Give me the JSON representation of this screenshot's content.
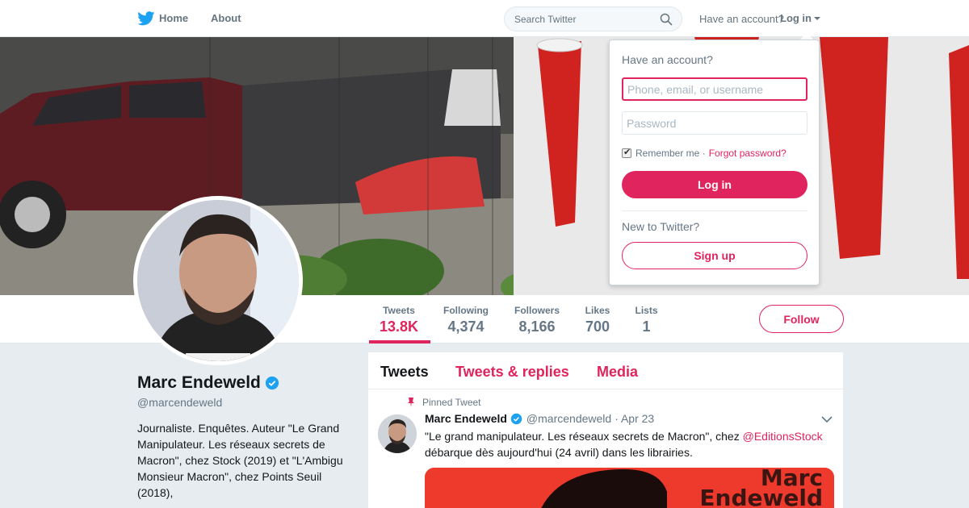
{
  "topnav": {
    "home_label": "Home",
    "about_label": "About",
    "search_placeholder": "Search Twitter",
    "have_account": "Have an account?",
    "login_label": "Log in"
  },
  "profile": {
    "name": "Marc Endeweld",
    "handle": "@marcendeweld",
    "bio": "Journaliste. Enquêtes. Auteur \"Le Grand Manipulateur. Les réseaux secrets de Macron\", chez Stock (2019) et \"L'Ambigu Monsieur Macron\", chez Points Seuil (2018),",
    "follow_label": "Follow"
  },
  "stats": [
    {
      "label": "Tweets",
      "value": "13.8K"
    },
    {
      "label": "Following",
      "value": "4,374"
    },
    {
      "label": "Followers",
      "value": "8,166"
    },
    {
      "label": "Likes",
      "value": "700"
    },
    {
      "label": "Lists",
      "value": "1"
    }
  ],
  "timeline": {
    "tabs": [
      "Tweets",
      "Tweets & replies",
      "Media"
    ],
    "pinned_label": "Pinned Tweet",
    "tweet": {
      "name": "Marc Endeweld",
      "handle": "@marcendeweld",
      "date": "· Apr 23",
      "text_before": "\"Le grand manipulateur. Les réseaux secrets de Macron\", chez ",
      "mention": "@EditionsStock",
      "text_after": " débarque dès aujourd'hui (24 avril) dans les librairies.",
      "media_line1": "Marc",
      "media_line2": "Endeweld"
    }
  },
  "login_dropdown": {
    "title": "Have an account?",
    "username_placeholder": "Phone, email, or username",
    "password_placeholder": "Password",
    "remember_label": "Remember me ·",
    "forgot_label": "Forgot password?",
    "login_button": "Log in",
    "new_label": "New to Twitter?",
    "signup_button": "Sign up"
  },
  "colors": {
    "accent": "#e0245e",
    "verified": "#1da1f2",
    "twitter_blue": "#1da1f2"
  }
}
